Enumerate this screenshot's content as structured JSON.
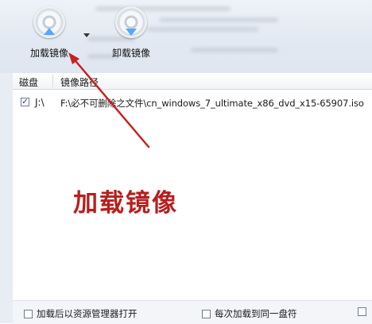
{
  "toolbar": {
    "mount_label": "加载镜像",
    "unmount_label": "卸载镜像",
    "mount_icon": "disc-up-icon",
    "unmount_icon": "disc-down-icon"
  },
  "list": {
    "columns": [
      "磁盘",
      "镜像路径"
    ],
    "rows": [
      {
        "checked": true,
        "drive": "J:\\",
        "path": "F:\\必不可删除之文件\\cn_windows_7_ultimate_x86_dvd_x15-65907.iso"
      }
    ]
  },
  "annotation": {
    "text": "加载镜像",
    "color": "#b81e1e"
  },
  "options": {
    "open_in_explorer": "加载后以资源管理器打开",
    "same_drive": "每次加载到同一盘符"
  },
  "colors": {
    "accent_arrow": "#55a8ff",
    "annotation_red": "#b81e1e"
  }
}
